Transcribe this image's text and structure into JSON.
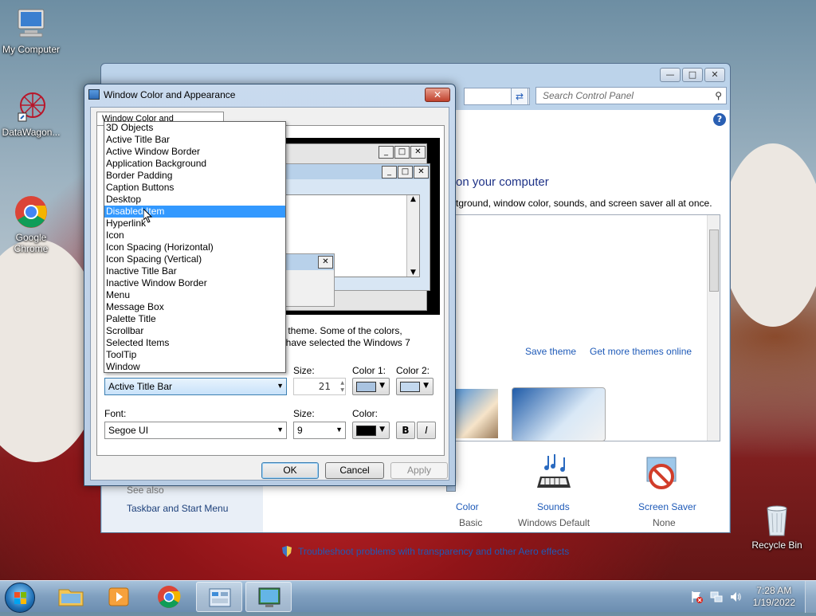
{
  "desktop": {
    "icons": [
      {
        "label": "My Computer"
      },
      {
        "label": "DataWagon..."
      },
      {
        "label": "Google\nChrome"
      },
      {
        "label": "Recycle Bin"
      }
    ]
  },
  "control_panel": {
    "search_placeholder": "Search Control Panel",
    "heading": "on your computer",
    "subheading": "tground, window color, sounds, and screen saver all at once.",
    "save_theme": "Save theme",
    "get_more_themes": "Get more themes online",
    "see_also": "See also",
    "taskbar_link": "Taskbar and Start Menu",
    "troubleshoot_link": "Troubleshoot problems with transparency and other Aero effects",
    "color_label": "Color",
    "color_value": "Basic",
    "sounds_label": "Sounds",
    "sounds_value": "Windows Default",
    "screensaver_label": "Screen Saver",
    "screensaver_value": "None"
  },
  "dialog": {
    "title": "Window Color and Appearance",
    "tab_label": "Window Color and Appearance",
    "description_line1": "s 7 theme.  Some of the colors,",
    "description_line2": "ou have selected the Windows 7",
    "item_selected": "Active Title Bar",
    "size_label": "Size:",
    "size_value": "21",
    "color1_label": "Color 1:",
    "color2_label": "Color 2:",
    "color1_hex": "#a9c3e0",
    "color2_hex": "#c3d8ee",
    "font_label": "Font:",
    "font_value": "Segoe UI",
    "font_size_label": "Size:",
    "font_size_value": "9",
    "font_color_label": "Color:",
    "font_color_hex": "#000000",
    "bold_label": "B",
    "italic_label": "I",
    "ok_label": "OK",
    "cancel_label": "Cancel",
    "apply_label": "Apply"
  },
  "dropdown": {
    "selected_index": 7,
    "items": [
      "3D Objects",
      "Active Title Bar",
      "Active Window Border",
      "Application Background",
      "Border Padding",
      "Caption Buttons",
      "Desktop",
      "Disabled Item",
      "Hyperlink",
      "Icon",
      "Icon Spacing (Horizontal)",
      "Icon Spacing (Vertical)",
      "Inactive Title Bar",
      "Inactive Window Border",
      "Menu",
      "Message Box",
      "Palette Title",
      "Scrollbar",
      "Selected Items",
      "ToolTip",
      "Window"
    ]
  },
  "taskbar": {
    "time": "7:28 AM",
    "date": "1/19/2022"
  }
}
